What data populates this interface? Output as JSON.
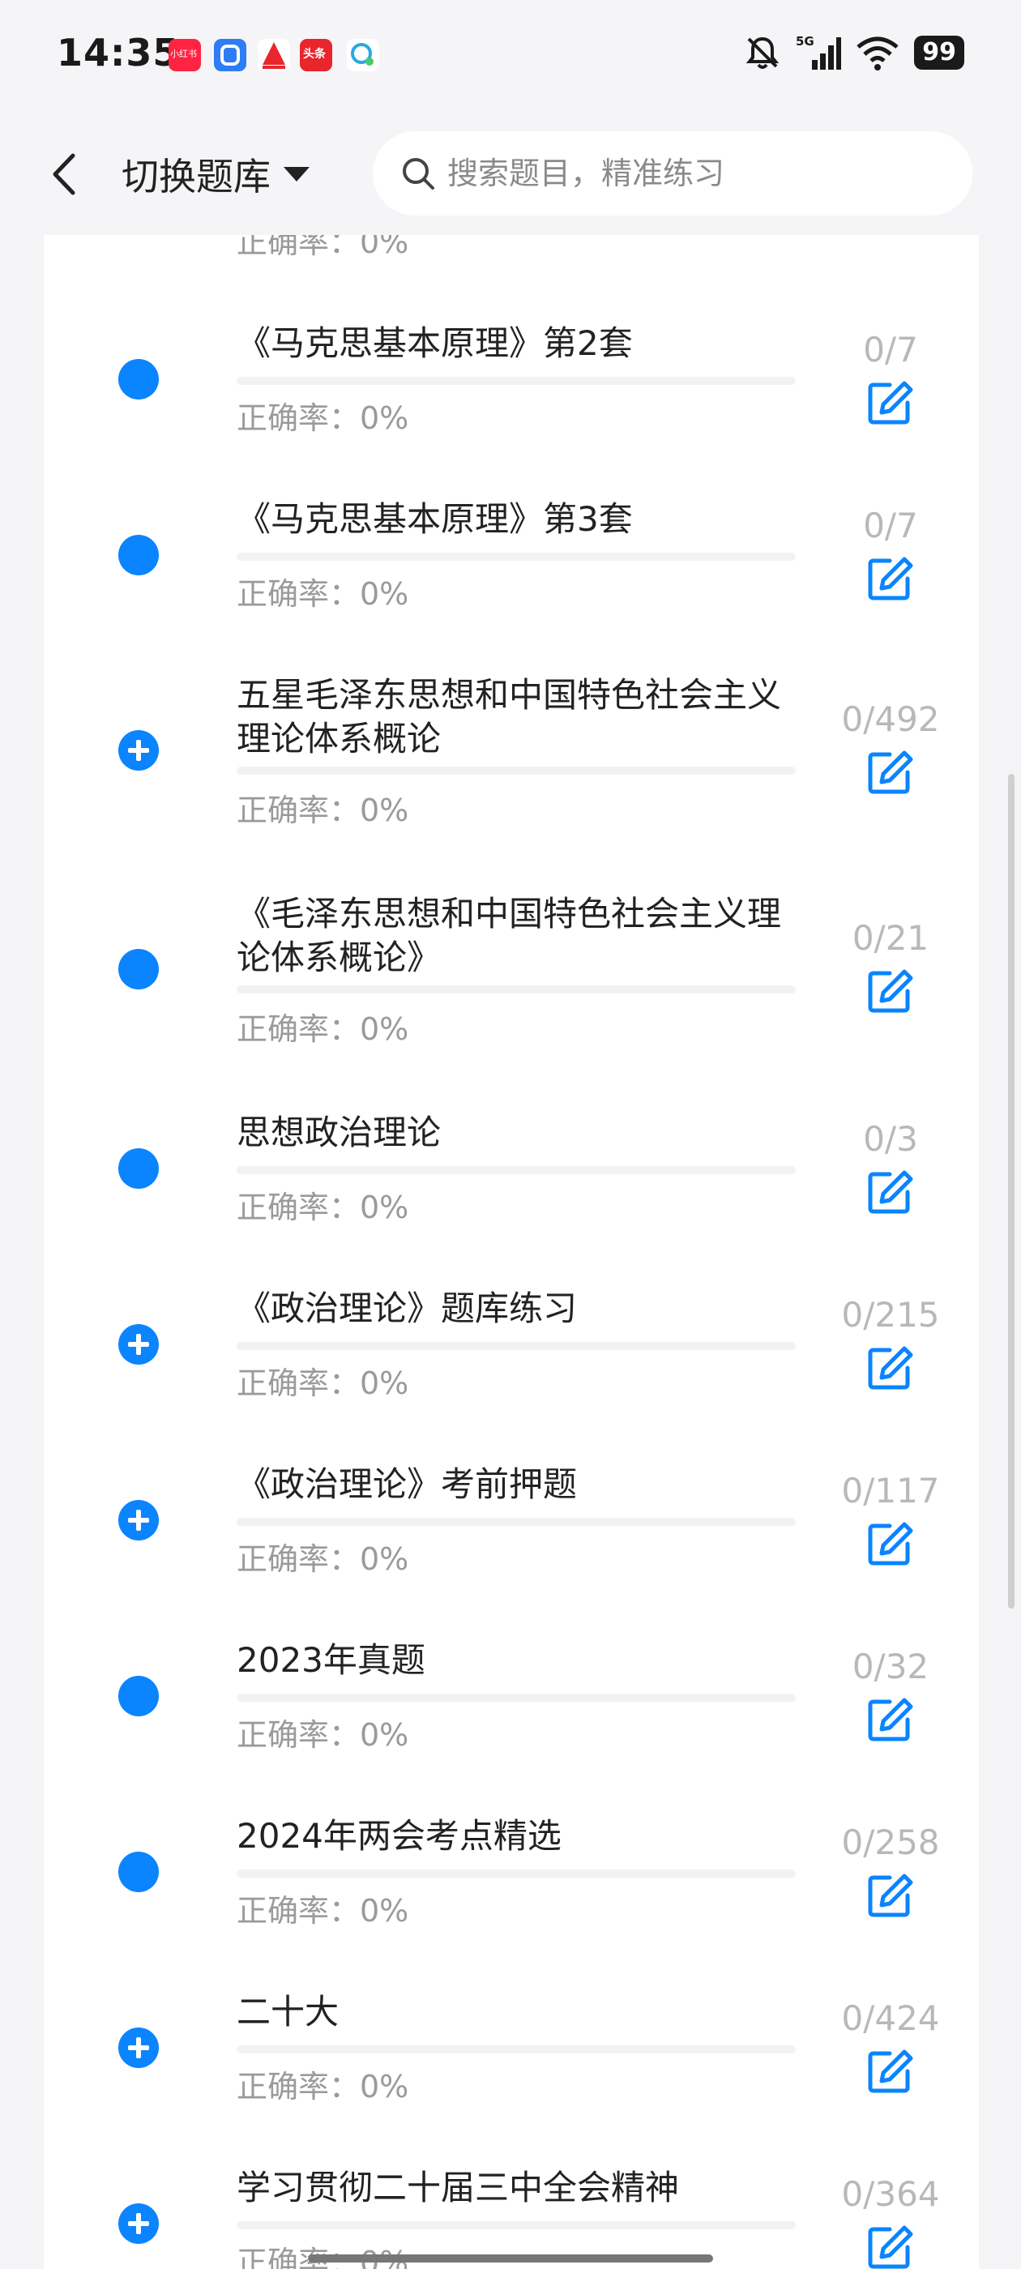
{
  "status": {
    "time": "14:35",
    "battery": "99",
    "notif_badge_1": "小红书",
    "notif_badge_4": "头条"
  },
  "header": {
    "title": "切换题库",
    "search_placeholder": "搜索题目，精准练习"
  },
  "items": [
    {
      "title": "",
      "rate": "正确率：0%",
      "count": "",
      "icon": "dot"
    },
    {
      "title": "《马克思基本原理》第2套",
      "rate": "正确率：0%",
      "count": "0/7",
      "icon": "dot"
    },
    {
      "title": "《马克思基本原理》第3套",
      "rate": "正确率：0%",
      "count": "0/7",
      "icon": "dot"
    },
    {
      "title": "五星毛泽东思想和中国特色社会主义理论体系概论",
      "rate": "正确率：0%",
      "count": "0/492",
      "icon": "plus"
    },
    {
      "title": "《毛泽东思想和中国特色社会主义理论体系概论》",
      "rate": "正确率：0%",
      "count": "0/21",
      "icon": "dot"
    },
    {
      "title": "思想政治理论",
      "rate": "正确率：0%",
      "count": "0/3",
      "icon": "dot"
    },
    {
      "title": "《政治理论》题库练习",
      "rate": "正确率：0%",
      "count": "0/215",
      "icon": "plus"
    },
    {
      "title": "《政治理论》考前押题",
      "rate": "正确率：0%",
      "count": "0/117",
      "icon": "plus"
    },
    {
      "title": "2023年真题",
      "rate": "正确率：0%",
      "count": "0/32",
      "icon": "dot"
    },
    {
      "title": "2024年两会考点精选",
      "rate": "正确率：0%",
      "count": "0/258",
      "icon": "dot"
    },
    {
      "title": "二十大",
      "rate": "正确率：0%",
      "count": "0/424",
      "icon": "plus"
    },
    {
      "title": "学习贯彻二十届三中全会精神",
      "rate": "正确率：0%",
      "count": "0/364",
      "icon": "plus"
    }
  ],
  "colors": {
    "accent": "#0a84ff",
    "muted_text": "#9a9a9a",
    "count_text": "#b8b8b8"
  }
}
